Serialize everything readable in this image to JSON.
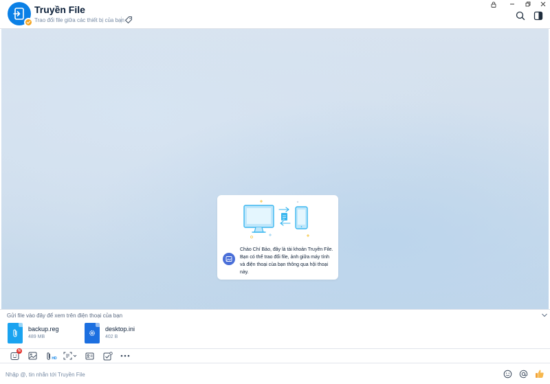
{
  "header": {
    "title": "Truyền File",
    "subtitle": "Trao đổi file giữa các thiết bị của bạn",
    "icons": [
      "file-transfer-icon",
      "verified-badge-icon",
      "tag-icon",
      "lock-icon",
      "minimize-icon",
      "restore-icon",
      "close-icon",
      "search-icon",
      "sidebar-toggle-icon"
    ]
  },
  "welcome": {
    "message": "Chào Chí Bảo, đây là tài khoản Truyền File. Bạn có thể trao đổi file, ảnh giữa máy tính và điện thoại của bạn thông qua hội thoại này."
  },
  "dropzone": {
    "label": "Gửi file vào đây để xem trên điện thoại của bạn",
    "files": [
      {
        "name": "backup.reg",
        "size": "489 MB",
        "icon": "attachment-icon",
        "color": "#1aa3f0"
      },
      {
        "name": "desktop.ini",
        "size": "402 B",
        "icon": "settings-icon",
        "color": "#1c6fe0"
      }
    ]
  },
  "toolbar": {
    "sticker_badge": "N",
    "hd_label": "HD",
    "icons": [
      "sticker-icon",
      "image-icon",
      "attachment-hd-icon",
      "screenshot-icon",
      "contact-card-icon",
      "task-icon",
      "more-icon"
    ]
  },
  "composer": {
    "placeholder": "Nhập @, tin nhắn tới Truyền File",
    "icons": [
      "emoji-icon",
      "mention-icon",
      "thumbs-up-icon"
    ]
  },
  "colors": {
    "accent": "#0a80e6",
    "verified": "#f5a623",
    "badge": "#e5322d",
    "thumbs_up": "#f2a33a"
  }
}
